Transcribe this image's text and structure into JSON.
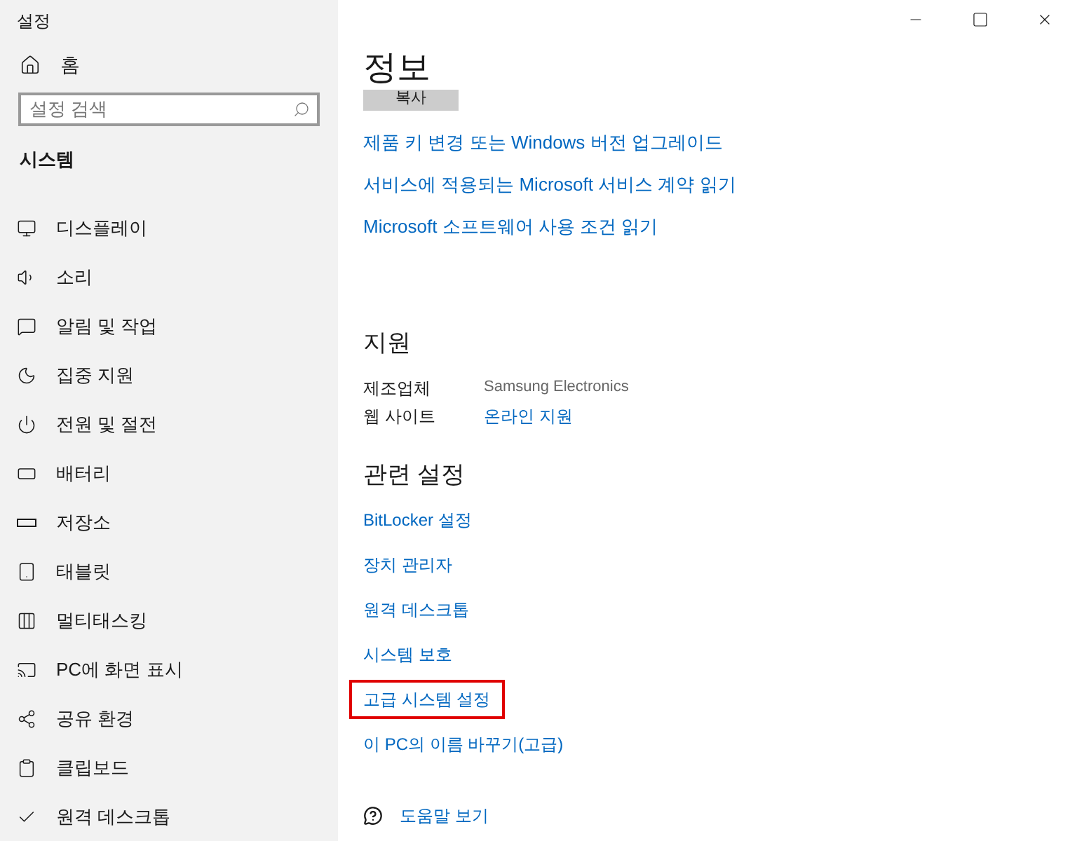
{
  "window": {
    "title": "설정"
  },
  "sidebar": {
    "home": "홈",
    "search": {
      "placeholder": "설정 검색"
    },
    "section": "시스템",
    "items": [
      {
        "kind": "display",
        "label": "디스플레이"
      },
      {
        "kind": "sound",
        "label": "소리"
      },
      {
        "kind": "notification",
        "label": "알림 및 작업"
      },
      {
        "kind": "focus",
        "label": "집중 지원"
      },
      {
        "kind": "power",
        "label": "전원 및 절전"
      },
      {
        "kind": "battery",
        "label": "배터리"
      },
      {
        "kind": "storage",
        "label": "저장소"
      },
      {
        "kind": "tablet",
        "label": "태블릿"
      },
      {
        "kind": "multitask",
        "label": "멀티태스킹"
      },
      {
        "kind": "project",
        "label": "PC에 화면 표시"
      },
      {
        "kind": "share",
        "label": "공유 환경"
      },
      {
        "kind": "clipboard",
        "label": "클립보드"
      },
      {
        "kind": "remote",
        "label": "원격 데스크톱"
      }
    ]
  },
  "content": {
    "title": "정보",
    "copy_button": "복사",
    "top_links": [
      "제품 키 변경 또는 Windows 버전 업그레이드",
      "서비스에 적용되는 Microsoft 서비스 계약 읽기",
      "Microsoft 소프트웨어 사용 조건 읽기"
    ],
    "support": {
      "heading": "지원",
      "rows": [
        {
          "label": "제조업체",
          "value": "Samsung Electronics",
          "link": false
        },
        {
          "label": "웹 사이트",
          "value": "온라인 지원",
          "link": true
        }
      ]
    },
    "related": {
      "heading": "관련 설정",
      "links": [
        {
          "label": "BitLocker 설정",
          "highlighted": false
        },
        {
          "label": "장치 관리자",
          "highlighted": false
        },
        {
          "label": "원격 데스크톱",
          "highlighted": false
        },
        {
          "label": "시스템 보호",
          "highlighted": false
        },
        {
          "label": "고급 시스템 설정",
          "highlighted": true
        },
        {
          "label": "이 PC의 이름 바꾸기(고급)",
          "highlighted": false
        }
      ]
    },
    "help": "도움말 보기"
  }
}
